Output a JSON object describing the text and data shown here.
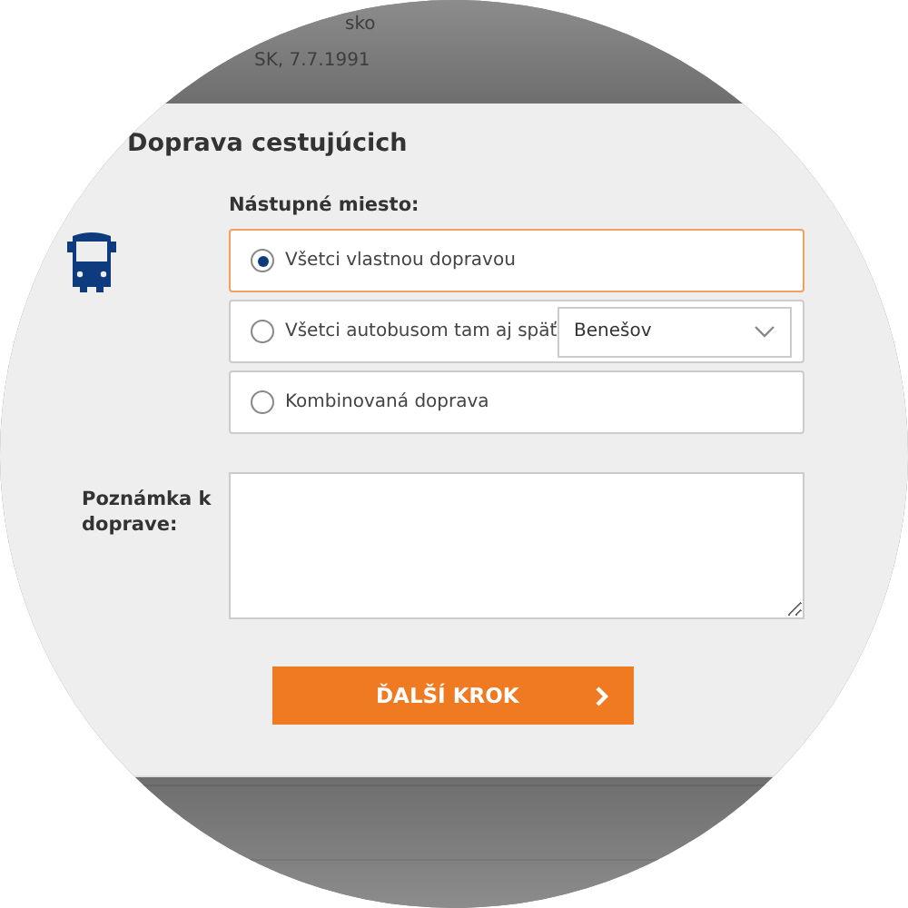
{
  "background": {
    "lines": [
      "sko",
      "SK, 7.7.1991"
    ]
  },
  "dialog": {
    "title": "Doprava cestujúcich",
    "boarding_label": "Nástupné miesto:",
    "options": [
      {
        "label": "Všetci vlastnou dopravou",
        "selected": true
      },
      {
        "label": "Všetci autobusom tam aj späť",
        "selected": false,
        "select": {
          "value": "Benešov"
        }
      },
      {
        "label": "Kombinovaná doprava",
        "selected": false
      }
    ],
    "note": {
      "label": "Poznámka k doprave:"
    },
    "next_button": {
      "label": "ĎALŠÍ KROK"
    }
  }
}
